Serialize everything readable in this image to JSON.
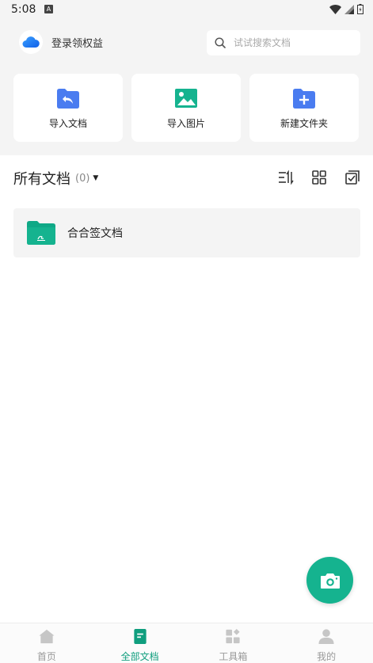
{
  "status_bar": {
    "time": "5:08",
    "badge": "A"
  },
  "header": {
    "login_text": "登录领权益",
    "search_placeholder": "试试搜索文档"
  },
  "quick_actions": [
    {
      "label": "导入文档",
      "icon": "import-doc-icon"
    },
    {
      "label": "导入图片",
      "icon": "import-image-icon"
    },
    {
      "label": "新建文件夹",
      "icon": "new-folder-icon"
    }
  ],
  "docs": {
    "title": "所有文档",
    "count": "(0)",
    "folders": [
      {
        "name": "合合签文档"
      }
    ]
  },
  "bottom_nav": [
    {
      "label": "首页",
      "icon": "home-icon",
      "active": false
    },
    {
      "label": "全部文档",
      "icon": "document-icon",
      "active": true
    },
    {
      "label": "工具箱",
      "icon": "toolbox-icon",
      "active": false
    },
    {
      "label": "我的",
      "icon": "profile-icon",
      "active": false
    }
  ],
  "colors": {
    "accent": "#15b38f",
    "active_nav": "#0f9e7e",
    "folder_blue": "#4a7cf0"
  }
}
